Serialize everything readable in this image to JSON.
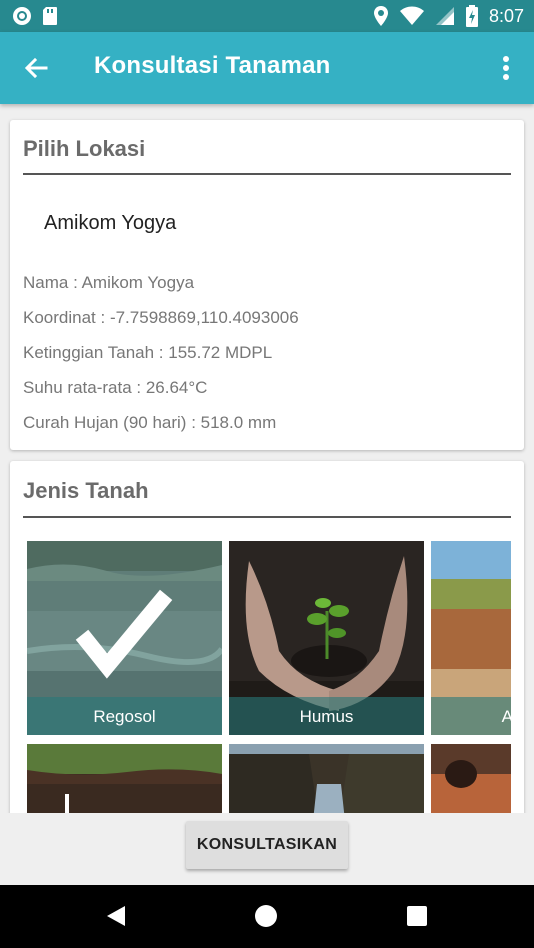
{
  "status_bar": {
    "time": "8:07"
  },
  "app_bar": {
    "title": "Konsultasi Tanaman"
  },
  "location_card": {
    "title": "Pilih Lokasi",
    "selected_location": "Amikom Yogya",
    "info": [
      "Nama : Amikom Yogya",
      "Koordinat : -7.7598869,110.4093006",
      "Ketinggian Tanah : 155.72 MDPL",
      "Suhu rata-rata : 26.64°C",
      "Curah Hujan (90 hari) : 518.0 mm"
    ]
  },
  "soil_card": {
    "title": "Jenis Tanah",
    "types": [
      {
        "label": "Regosol",
        "selected": true
      },
      {
        "label": "Humus",
        "selected": false
      },
      {
        "label": "A",
        "selected": false
      }
    ]
  },
  "action": {
    "button_label": "KONSULTASIKAN"
  },
  "colors": {
    "status_bar": "#27898f",
    "app_bar": "#35b1c4",
    "label_overlay": "#287878"
  }
}
